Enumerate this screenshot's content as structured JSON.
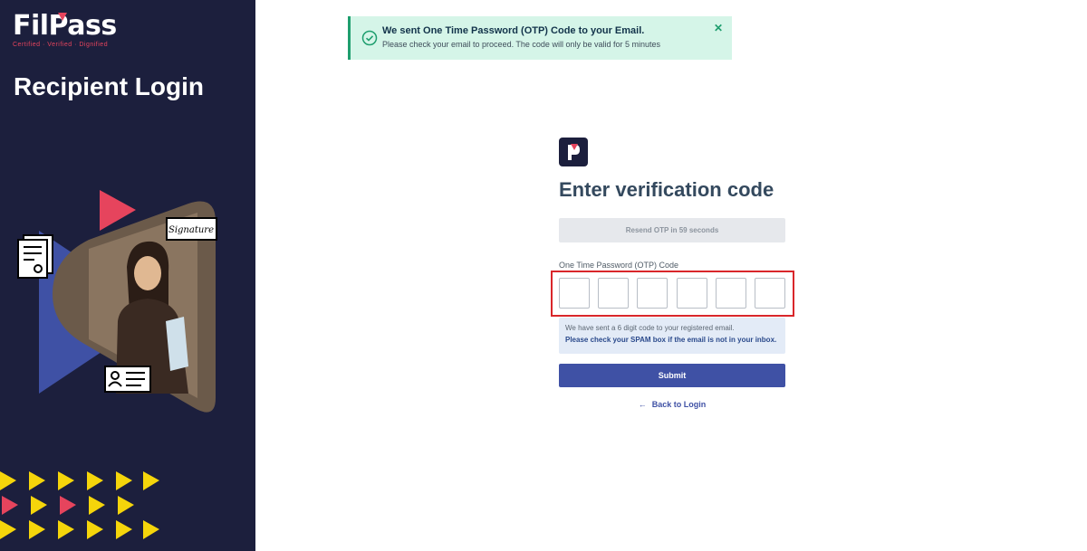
{
  "brand": {
    "name": "FilPass",
    "tagline": "Certified · Verified · Dignified",
    "colors": {
      "panel": "#1c1f3d",
      "accent": "#e6445d",
      "primary": "#3f51a5"
    }
  },
  "left": {
    "title": "Recipient Login",
    "signature_label": "Signature"
  },
  "toast": {
    "title": "We sent One Time Password (OTP) Code to your Email.",
    "message": "Please check your email to proceed. The code will only be valid for 5 minutes",
    "close_icon": "close-icon",
    "check_icon": "check-circle-icon"
  },
  "form": {
    "title": "Enter verification code",
    "resend_label": "Resend OTP in 59 seconds",
    "otp_label": "One Time Password (OTP) Code",
    "otp_values": [
      "",
      "",
      "",
      "",
      "",
      ""
    ],
    "info_line1": "We have sent a 6 digit code to your registered email.",
    "info_line2": "Please check your SPAM box if the email is not in your inbox.",
    "submit_label": "Submit",
    "back_label": "Back to Login",
    "back_icon": "arrow-left-icon"
  }
}
